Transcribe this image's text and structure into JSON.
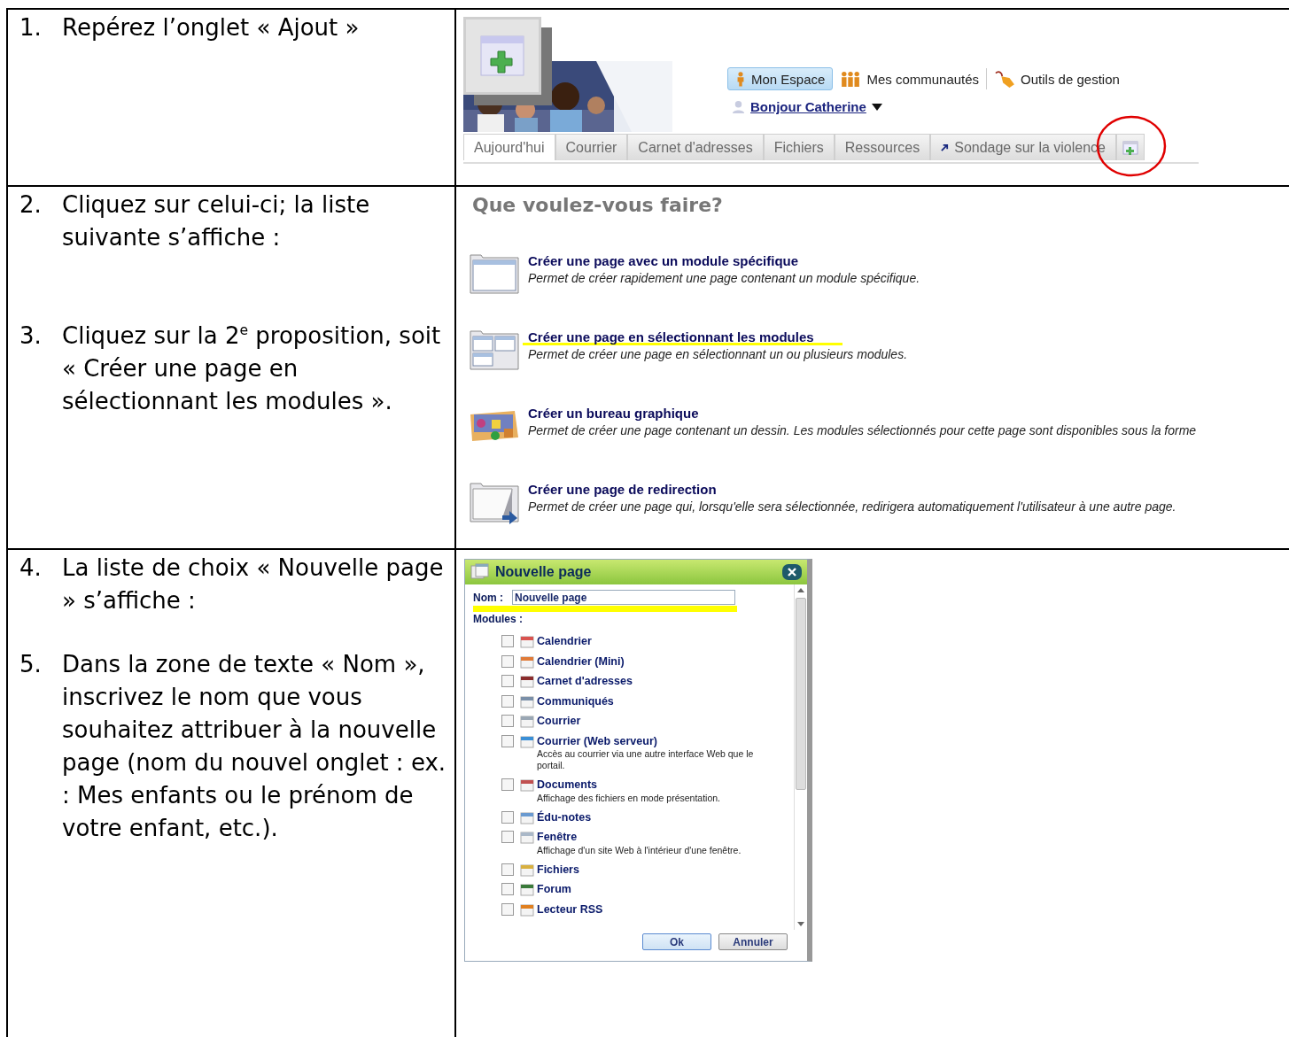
{
  "rows": [
    {
      "instructions": [
        {
          "number": "1.",
          "text": "Repérez l’onglet « Ajout »"
        }
      ]
    },
    {
      "instructions": [
        {
          "number": "2.",
          "text": "Cliquez sur celui-ci; la liste suivante s’affiche :"
        },
        {
          "number": "3.",
          "text": "Cliquez sur la 2$^{e}$ proposition, soit « Créer une page en sélectionnant les modules »."
        }
      ]
    },
    {
      "instructions": [
        {
          "number": "4.",
          "text": "La liste de choix « Nouvelle page » s’affiche :"
        },
        {
          "number": "5.",
          "text": "Dans la zone de texte « Nom », inscrivez le nom que vous souhaitez attribuer à la nouvelle page (nom du nouvel onglet : ex. : Mes enfants ou le prénom de votre enfant, etc.)."
        }
      ]
    }
  ],
  "portal": {
    "nav_links": [
      {
        "label": "Mon Espace",
        "selected": true
      },
      {
        "label": "Mes communautés",
        "selected": false
      },
      {
        "label": "Outils de gestion",
        "selected": false
      }
    ],
    "greeting": "Bonjour Catherine",
    "tabs": [
      {
        "kind": "text",
        "label": "Aujourd'hui",
        "selected": true,
        "circled": false
      },
      {
        "kind": "text",
        "label": "Courrier",
        "selected": false,
        "circled": false
      },
      {
        "kind": "text",
        "label": "Carnet d'adresses",
        "selected": false,
        "circled": false
      },
      {
        "kind": "text",
        "label": "Fichiers",
        "selected": false,
        "circled": false
      },
      {
        "kind": "text",
        "label": "Ressources",
        "selected": false,
        "circled": false
      },
      {
        "kind": "link",
        "label": "Sondage sur la violence",
        "selected": false,
        "circled": false
      },
      {
        "kind": "add",
        "selected": false,
        "circled": true
      }
    ]
  },
  "choices": {
    "title": "Que voulez-vous faire?",
    "options": [
      {
        "title": "Créer une page avec un module spécifique",
        "description": "Permet de créer rapidement une page contenant un module spécifique.",
        "highlighted": false
      },
      {
        "title": "Créer une page en sélectionnant les modules",
        "description": "Permet de créer une page en sélectionnant un ou plusieurs modules.",
        "highlighted": true
      },
      {
        "title": "Créer un bureau graphique",
        "description": "Permet de créer une page contenant un dessin. Les modules sélectionnés pour cette page sont disponibles sous la forme",
        "highlighted": false
      },
      {
        "title": "Créer une page de redirection",
        "description": "Permet de créer une page qui, lorsqu'elle sera sélectionnée, redirigera automatiquement l'utilisateur à une autre page.",
        "highlighted": false
      }
    ]
  },
  "dialog": {
    "title": "Nouvelle page",
    "name_label": "Nom :",
    "name_value": "Nouvelle page",
    "name_highlighted": true,
    "modules_label": "Modules :",
    "modules": [
      {
        "label": "Calendrier",
        "checked": false
      },
      {
        "label": "Calendrier (Mini)",
        "checked": false
      },
      {
        "label": "Carnet d'adresses",
        "checked": false
      },
      {
        "label": "Communiqués",
        "checked": false
      },
      {
        "label": "Courrier",
        "checked": false
      },
      {
        "label": "Courrier (Web serveur)",
        "description": "Accès au courrier via une autre interface Web que le portail.",
        "checked": false
      },
      {
        "label": "Documents",
        "description": "Affichage des fichiers en mode présentation.",
        "checked": false
      },
      {
        "label": "Édu-notes",
        "checked": false
      },
      {
        "label": "Fenêtre",
        "description": "Affichage d'un site Web à l'intérieur d'une fenêtre.",
        "checked": false
      },
      {
        "label": "Fichiers",
        "checked": false
      },
      {
        "label": "Forum",
        "checked": false
      },
      {
        "label": "Lecteur RSS",
        "checked": false
      }
    ],
    "buttons": [
      "Ok",
      "Annuler"
    ]
  }
}
